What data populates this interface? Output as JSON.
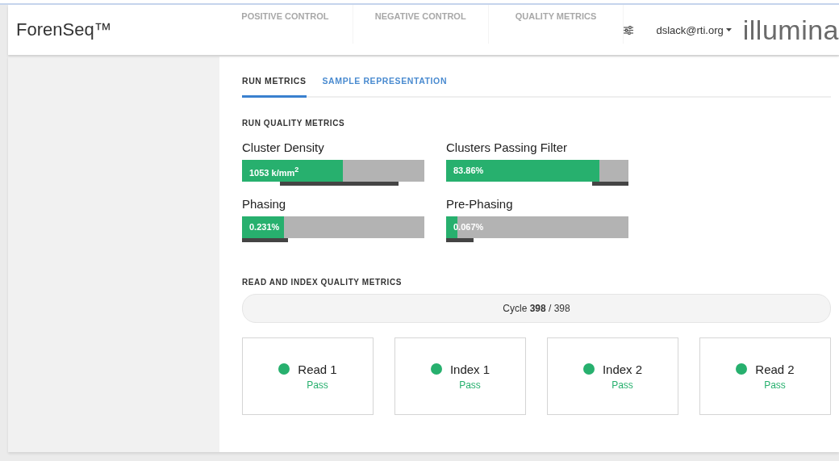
{
  "header": {
    "brand": "ForenSeq™",
    "faded_tabs": [
      "POSITIVE CONTROL",
      "NEGATIVE CONTROL",
      "QUALITY METRICS"
    ],
    "user": "dslack@rti.org",
    "logo": "illumina"
  },
  "tabs": [
    {
      "label": "RUN METRICS",
      "selected": true
    },
    {
      "label": "SAMPLE REPRESENTATION",
      "selected": false
    }
  ],
  "run_quality": {
    "title": "RUN QUALITY METRICS",
    "metrics": [
      {
        "name": "Cluster Density",
        "value": "1053 k/mm$^{2}$",
        "level": 0.553
      },
      {
        "name": "Clusters Passing Filter",
        "value": "83.86%",
        "level": 0.84
      },
      {
        "name": "Phasing",
        "value": "0.231%",
        "level": 0.23
      },
      {
        "name": "Pre-Phasing",
        "value": "0.067%",
        "level": 0.06
      }
    ]
  },
  "read_index": {
    "title": "READ AND INDEX QUALITY METRICS",
    "cycle": "Cycle **398** / 398",
    "reads": [
      {
        "name": "Read 1",
        "status": "Pass",
        "color": "#27b06e"
      },
      {
        "name": "Index 1",
        "status": "Pass",
        "color": "#27b06e"
      },
      {
        "name": "Index 2",
        "status": "Pass",
        "color": "#27b06e"
      },
      {
        "name": "Read 2",
        "status": "Pass",
        "color": "#27b06e"
      }
    ]
  }
}
